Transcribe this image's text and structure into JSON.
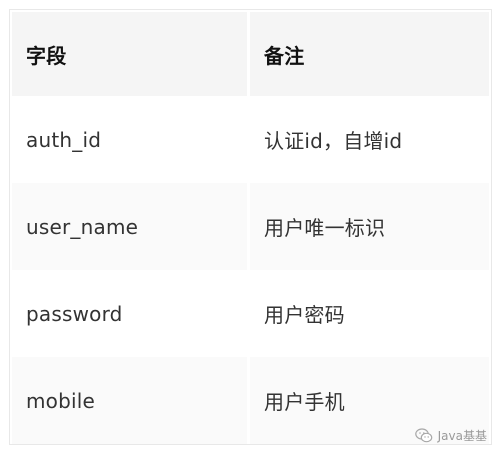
{
  "table": {
    "headers": [
      "字段",
      "备注"
    ],
    "rows": [
      {
        "field": "auth_id",
        "note": "认证id，自增id"
      },
      {
        "field": "user_name",
        "note": "用户唯一标识"
      },
      {
        "field": "password",
        "note": "用户密码"
      },
      {
        "field": "mobile",
        "note": "用户手机"
      }
    ]
  },
  "watermark": {
    "text": "Java基基",
    "icon": "wechat-icon"
  }
}
